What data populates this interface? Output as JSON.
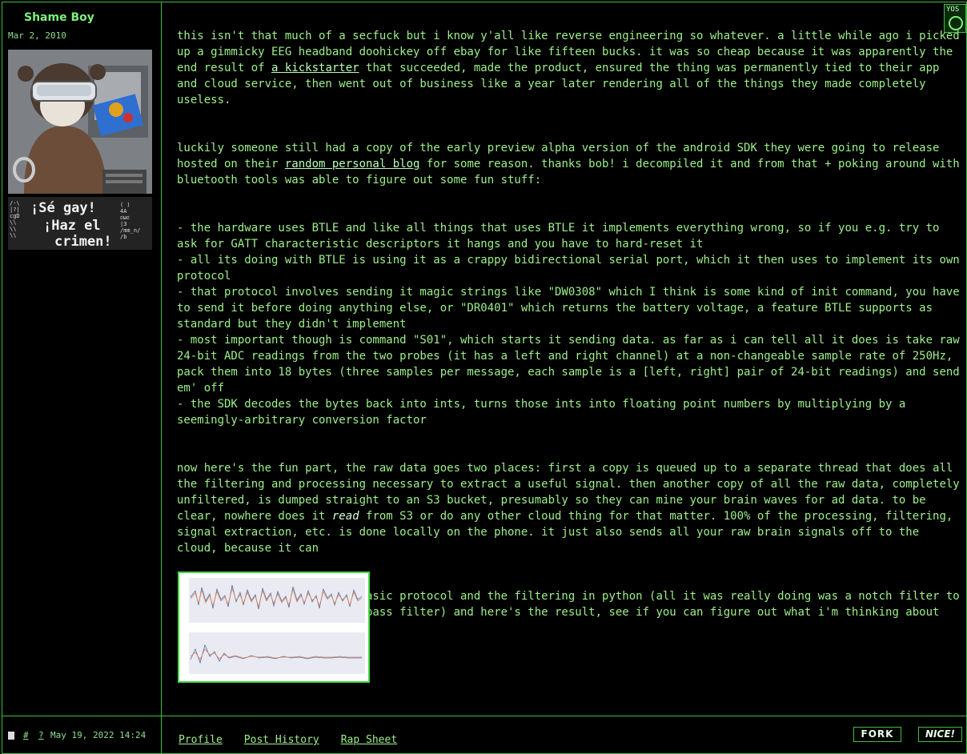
{
  "author": {
    "username": "Shame Boy",
    "join_date": "Mar 2, 2010",
    "banner_text": [
      "¡Sé gay!",
      "¡Haz el",
      "crimen!"
    ]
  },
  "corner_icon_text": "YOS",
  "post": {
    "p1": {
      "before": "this isn't that much of a secfuck but i know y'all like reverse engineering so whatever. a little while ago i picked up a gimmicky EEG headband doohickey off ebay for like fifteen bucks. it was so cheap because it was apparently the end result of ",
      "link": "a kickstarter",
      "after": " that succeeded, made the product, ensured the thing was permanently tied to their app and cloud service, then went out of business like a year later rendering all of the things they made completely useless."
    },
    "p2": {
      "before": "luckily someone still had a copy of the early preview alpha version of the android SDK they were going to release hosted on their ",
      "link": "random personal blog",
      "after": " for some reason. thanks bob! i decompiled it and from that + poking around with bluetooth tools was able to figure out some fun stuff:"
    },
    "bullets": [
      "- the hardware uses BTLE and like all things that uses BTLE it implements everything wrong, so if you e.g. try to ask for GATT characteristic descriptors it hangs and you have to hard-reset it",
      "- all its doing with BTLE is using it as a crappy bidirectional serial port, which it then uses to implement its own protocol",
      "- that protocol involves sending it magic strings like \"DW0308\" which I think is some kind of init command, you have to send it before doing anything else, or \"DR0401\" which returns the battery voltage, a feature BTLE supports as standard but they didn't implement",
      "- most important though is command \"S01\", which starts it sending data. as far as i can tell all it does is take raw 24-bit ADC readings from the two probes (it has a left and right channel) at a non-changeable sample rate of 250Hz, pack them into 18 bytes (three samples per message, each sample is a [left, right] pair of 24-bit readings) and send em' off",
      "- the SDK decodes the bytes back into ints, turns those ints into floating point numbers by multiplying by a seemingly-arbitrary conversion factor"
    ],
    "p3": {
      "before": "now here's the fun part, the raw data goes two places: first a copy is queued up to a separate thread that does all the filtering and processing necessary to extract a useful signal. then another copy of all the raw data, completely unfiltered, is dumped straight to an S3 bucket, presumably so they can mine your brain waves for ad data. to be clear, nowhere does it ",
      "em": "read",
      "after": " from S3 or do any other cloud thing for that matter. 100% of the processing, filtering, signal extraction, etc. is done locally on the phone. it just also sends all your raw brain signals off to the cloud, because it can"
    },
    "p4": "anyway i reimplemented the basic protocol and the filtering in python (all it was really doing was a notch filter to kill any 60Hz hum and a bandpass filter) and here's the result, see if you can figure out what i'm thinking about here:"
  },
  "footer": {
    "hash_link": "#",
    "question_link": "?",
    "post_date": "May 19, 2022 14:24",
    "links": [
      "Profile",
      "Post History",
      "Rap Sheet"
    ],
    "fork_button": "FORK",
    "nice_button": "NICE!"
  },
  "colors": {
    "text": "#9ef08a",
    "border": "#3fbf3f",
    "background": "#000000"
  }
}
